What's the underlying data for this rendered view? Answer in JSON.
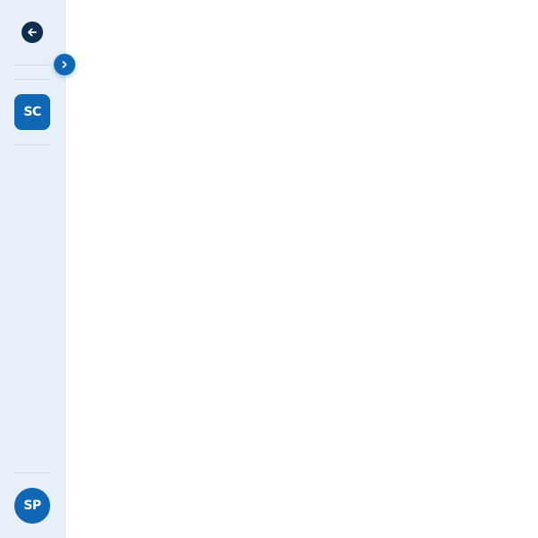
{
  "sidebar": {
    "back_icon": "arrow-left-icon",
    "expand_icon": "chevron-right-icon",
    "workspace": {
      "initials": "SC"
    },
    "user": {
      "initials": "SP"
    }
  },
  "colors": {
    "sidebar_bg": "#e7f0f8",
    "accent": "#1067b4",
    "dark_navy": "#0e2f4f",
    "main_bg": "#ffffff"
  }
}
